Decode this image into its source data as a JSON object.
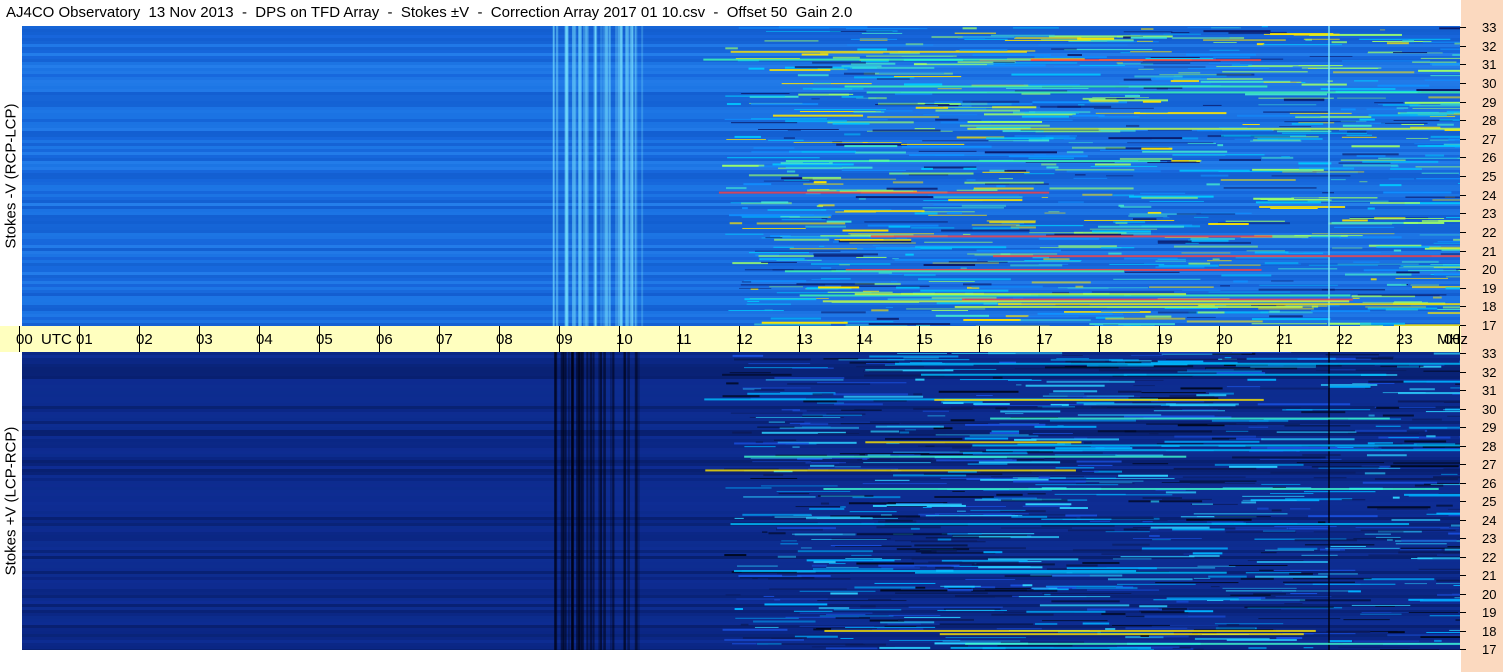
{
  "header": {
    "title": "AJ4CO Observatory  13 Nov 2013  -  DPS on TFD Array  -  Stokes ±V  -  Correction Array 2017 01 10.csv  -  Offset 50  Gain 2.0"
  },
  "panels": {
    "top": {
      "ylabel": "Stokes -V (RCP-LCP)"
    },
    "bottom": {
      "ylabel": "Stokes +V (LCP-RCP)"
    }
  },
  "time_axis": {
    "labels": [
      "00  UTC",
      "01",
      "02",
      "03",
      "04",
      "05",
      "06",
      "07",
      "08",
      "09",
      "10",
      "11",
      "12",
      "13",
      "14",
      "15",
      "16",
      "17",
      "18",
      "19",
      "20",
      "21",
      "22",
      "23",
      "00"
    ],
    "unit": "MHz"
  },
  "freq_axis": {
    "labels": [
      "33",
      "32",
      "31",
      "30",
      "29",
      "28",
      "27",
      "26",
      "25",
      "24",
      "23",
      "22",
      "21",
      "20",
      "19",
      "18",
      "17"
    ]
  },
  "colors": {
    "top_base": "#1a6fe0",
    "bottom_base": "#0c2a8a",
    "time_axis_bg": "#ffffbf",
    "freq_axis_bg": "#fbd9bf"
  }
}
